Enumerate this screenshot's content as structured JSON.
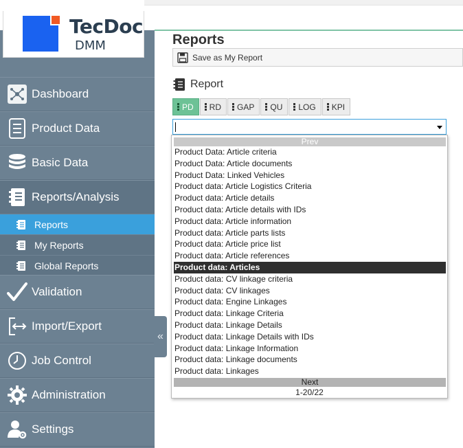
{
  "app": {
    "logo_line1": "TecDoc",
    "logo_line2": "DMM"
  },
  "sidebar": {
    "items": [
      {
        "label": "Dashboard",
        "icon": "network-icon"
      },
      {
        "label": "Product Data",
        "icon": "list-icon"
      },
      {
        "label": "Basic Data",
        "icon": "database-icon"
      },
      {
        "label": "Reports/Analysis",
        "icon": "notebook-icon"
      },
      {
        "label": "Validation",
        "icon": "check-icon"
      },
      {
        "label": "Import/Export",
        "icon": "import-export-icon"
      },
      {
        "label": "Job Control",
        "icon": "clock-icon"
      },
      {
        "label": "Administration",
        "icon": "gear-icon"
      },
      {
        "label": "Settings",
        "icon": "user-settings-icon"
      }
    ],
    "sub_items": [
      {
        "label": "Reports",
        "selected": true
      },
      {
        "label": "My Reports",
        "selected": false
      },
      {
        "label": "Global Reports",
        "selected": false
      }
    ],
    "collapse_glyph": "«"
  },
  "main": {
    "title": "Reports",
    "save_label": "Save as My Report",
    "report_heading": "Report",
    "tabs": [
      {
        "label": "PD",
        "active": true
      },
      {
        "label": "RD",
        "active": false
      },
      {
        "label": "GAP",
        "active": false
      },
      {
        "label": "QU",
        "active": false
      },
      {
        "label": "LOG",
        "active": false
      },
      {
        "label": "KPI",
        "active": false
      }
    ],
    "select_value": ""
  },
  "dropdown": {
    "prev_label": "Prev",
    "next_label": "Next",
    "page_info": "1-20/22",
    "highlighted_index": 10,
    "options": [
      "Product Data: Article criteria",
      "Product Data: Article documents",
      "Product Data: Linked Vehicles",
      "Product data: Article Logistics Criteria",
      "Product data: Article details",
      "Product data: Article details with IDs",
      "Product data: Article information",
      "Product data: Article parts lists",
      "Product data: Article price list",
      "Product data: Article references",
      "Product data: Articles",
      "Product data: CV linkage criteria",
      "Product data: CV linkages",
      "Product data: Engine Linkages",
      "Product data: Linkage Criteria",
      "Product data: Linkage Details",
      "Product data: Linkage Details with IDs",
      "Product data: Linkage Information",
      "Product data: Linkage documents",
      "Product data: Linkages"
    ]
  },
  "colors": {
    "sidebar": "#6c8192",
    "selected_sub": "#3aa0dc",
    "active_tab": "#6dc296",
    "highlight_option": "#2f2f2f"
  }
}
